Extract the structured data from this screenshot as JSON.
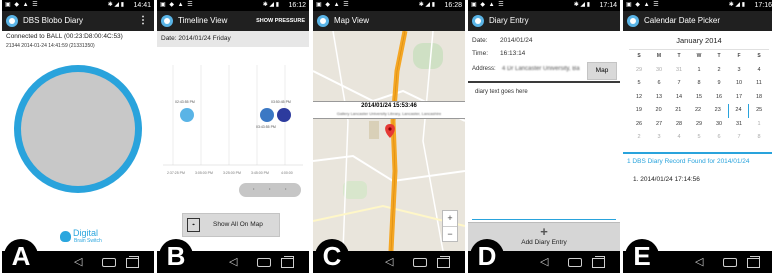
{
  "status_bars": [
    {
      "time": "14:41"
    },
    {
      "time": "16:12"
    },
    {
      "time": "16:28"
    },
    {
      "time": "17:14"
    },
    {
      "time": "17:16"
    }
  ],
  "panel_letters": [
    "A",
    "B",
    "C",
    "D",
    "E"
  ],
  "panel_a": {
    "title": "DBS Blobo Diary",
    "connected_text": "Connected to BALL (00:23:D8:00:4C:53)",
    "reading_text": "21344 2014-01-24 14:41:59 (21331350)",
    "logo_word": "Digital",
    "logo_sub": "Brain Switch"
  },
  "panel_b": {
    "title": "Timeline View",
    "action": "SHOW PRESSURE",
    "date": "Date: 2014/01/24 Friday",
    "points": [
      {
        "label": "02:43:55 PM"
      },
      {
        "label": "03:50:45 PM"
      },
      {
        "label": "03:43:55 PM"
      }
    ],
    "x_ticks": [
      "2:37:25 PM",
      "3:05:00 PM",
      "3:25:00 PM",
      "3:45:00 PM",
      "4:00:00"
    ],
    "show_all_label": "Show All On Map"
  },
  "panel_c": {
    "title": "Map View",
    "banner_time": "2014/01/24 15:53:46",
    "banner_address": "Gallery Lancaster University Library, Lancaster, Lancashire",
    "zoom_in": "+",
    "zoom_out": "−"
  },
  "panel_d": {
    "title": "Diary Entry",
    "date_label": "Date:",
    "date_value": "2014/01/24",
    "time_label": "Time:",
    "time_value": "16:13:14",
    "address_label": "Address:",
    "address_value": "4 Dr Lancaster University, Ba",
    "map_button": "Map",
    "text": "diary text goes here",
    "add_plus": "+",
    "add_label": "Add Diary Entry"
  },
  "panel_e": {
    "title": "Calendar Date Picker",
    "month": "January 2014",
    "weekdays": [
      "S",
      "M",
      "T",
      "W",
      "T",
      "F",
      "S"
    ],
    "weeks": [
      [
        "29",
        "30",
        "31",
        "1",
        "2",
        "3",
        "4"
      ],
      [
        "5",
        "6",
        "7",
        "8",
        "9",
        "10",
        "11"
      ],
      [
        "12",
        "13",
        "14",
        "15",
        "16",
        "17",
        "18"
      ],
      [
        "19",
        "20",
        "21",
        "22",
        "23",
        "24",
        "25"
      ],
      [
        "26",
        "27",
        "28",
        "29",
        "30",
        "31",
        "1"
      ],
      [
        "2",
        "3",
        "4",
        "5",
        "6",
        "7",
        "8"
      ]
    ],
    "found_text": "1 DBS Diary Record Found for 2014/01/24",
    "record": "1. 2014/01/24 17:14:56"
  },
  "colors": {
    "accent": "#29a3dc",
    "dark_bar": "#202020",
    "point_light": "#5ab4e6",
    "point_mid": "#3b78c4",
    "point_dark": "#2d3b9e",
    "road_orange": "#f5a623",
    "marker_red": "#e53935"
  }
}
